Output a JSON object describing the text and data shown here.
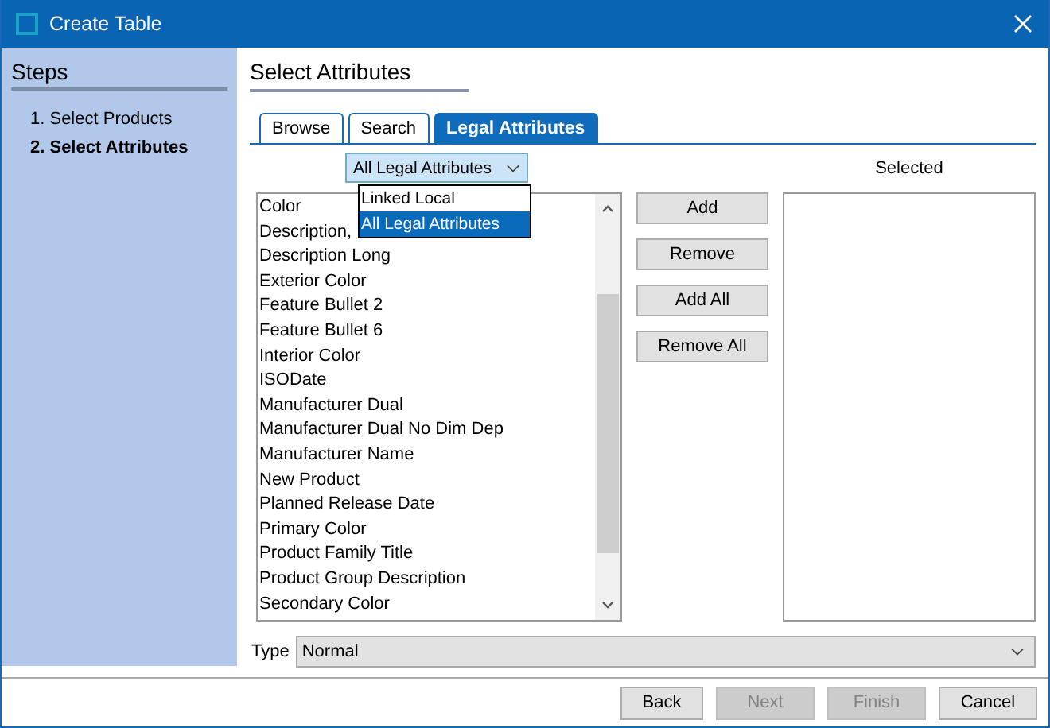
{
  "window": {
    "title": "Create Table"
  },
  "steps": {
    "title": "Steps",
    "items": [
      {
        "label": "1. Select Products",
        "selected": false
      },
      {
        "label": "2. Select Attributes",
        "selected": true
      }
    ]
  },
  "page": {
    "title": "Select Attributes"
  },
  "tabs": [
    {
      "label": "Browse",
      "selected": false
    },
    {
      "label": "Search",
      "selected": false
    },
    {
      "label": "Legal Attributes",
      "selected": true
    }
  ],
  "filter": {
    "value": "All Legal Attributes",
    "expanded": true,
    "options": [
      {
        "label": "Linked Local",
        "selected": false
      },
      {
        "label": "All Legal Attributes",
        "selected": true
      }
    ]
  },
  "available": {
    "items": [
      "Color",
      "Description,",
      "Description Long",
      "Exterior Color",
      "Feature Bullet 2",
      "Feature Bullet 6",
      "Interior Color",
      "ISODate",
      "Manufacturer Dual",
      "Manufacturer Dual No Dim Dep",
      "Manufacturer Name",
      "New Product",
      "Planned Release Date",
      "Primary Color",
      "Product Family Title",
      "Product Group Description",
      "Secondary Color"
    ]
  },
  "selected_list": {
    "label": "Selected"
  },
  "actions": [
    "Add",
    "Remove",
    "Add All",
    "Remove All"
  ],
  "type": {
    "label": "Type",
    "value": "Normal"
  },
  "buttons": [
    {
      "label": "Back",
      "disabled": false
    },
    {
      "label": "Next",
      "disabled": true
    },
    {
      "label": "Finish",
      "disabled": true
    },
    {
      "label": "Cancel",
      "disabled": false
    }
  ]
}
